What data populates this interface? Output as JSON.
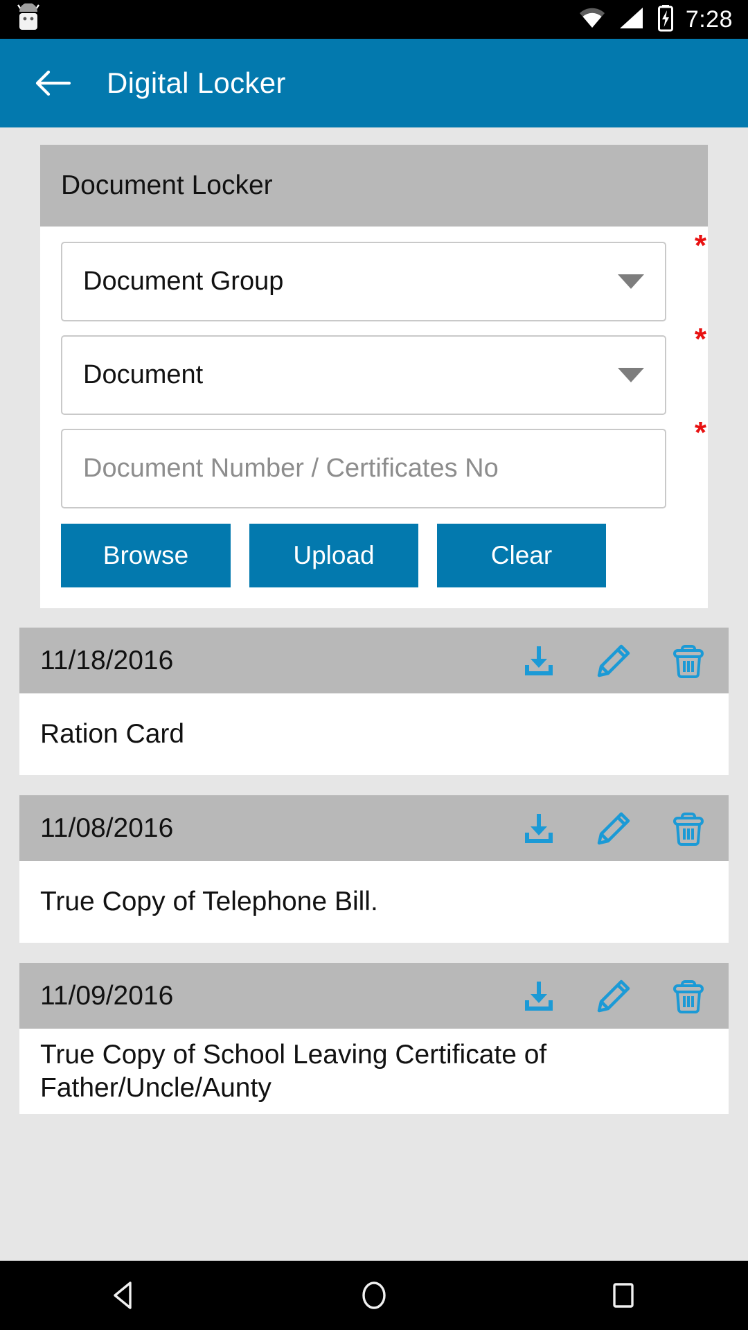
{
  "status_bar": {
    "time": "7:28",
    "icons": [
      "android-robot-icon",
      "wifi-icon",
      "cellular-signal-icon",
      "battery-charging-icon"
    ]
  },
  "app_bar": {
    "back_icon": "back-arrow-icon",
    "title": "Digital Locker",
    "color": "#0379AE"
  },
  "panel": {
    "header_title": "Document Locker",
    "header_bg": "#b8b8b8",
    "fields": [
      {
        "name": "document-group",
        "label": "Document Group",
        "type": "dropdown",
        "required": true,
        "required_marker": "*"
      },
      {
        "name": "document",
        "label": "Document",
        "type": "dropdown",
        "required": true,
        "required_marker": "*"
      },
      {
        "name": "document-number",
        "placeholder": "Document Number / Certificates No",
        "type": "text",
        "value": "",
        "required": true,
        "required_marker": "*"
      }
    ],
    "buttons": [
      {
        "name": "browse",
        "label": "Browse"
      },
      {
        "name": "upload",
        "label": "Upload"
      },
      {
        "name": "clear",
        "label": "Clear"
      }
    ],
    "button_color": "#0379AE",
    "required_color": "#e81111"
  },
  "documents": [
    {
      "date": "11/18/2016",
      "title": "Ration Card"
    },
    {
      "date": "11/08/2016",
      "title": "True Copy of Telephone Bill."
    },
    {
      "date": "11/09/2016",
      "title": "True Copy of School Leaving Certificate of Father/Uncle/Aunty"
    }
  ],
  "row_actions": {
    "download": "download-icon",
    "edit": "edit-pencil-icon",
    "delete": "trash-delete-icon",
    "color": "#1b9ad6"
  },
  "nav_bar": {
    "back": "nav-back-triangle-icon",
    "home": "nav-home-circle-icon",
    "recents": "nav-recents-square-icon"
  }
}
